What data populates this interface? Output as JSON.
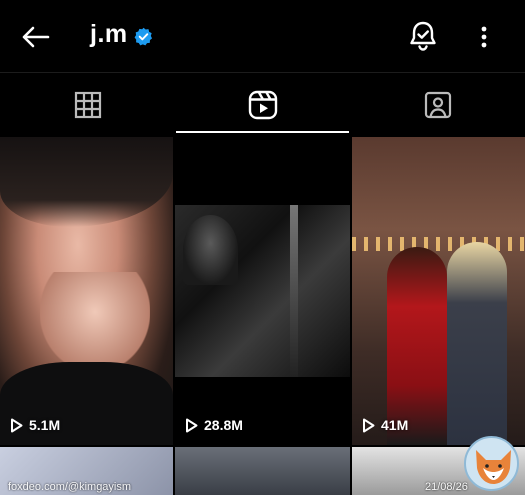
{
  "header": {
    "username": "j.m",
    "verified": true,
    "icons": {
      "back": "back-arrow-icon",
      "bell": "notification-bell-icon",
      "more": "more-vertical-icon",
      "verified": "verified-badge-icon"
    }
  },
  "tabs": [
    {
      "icon": "grid-icon",
      "active": false
    },
    {
      "icon": "reels-icon",
      "active": true
    },
    {
      "icon": "tagged-icon",
      "active": false
    }
  ],
  "reels": [
    {
      "views": "5.1M"
    },
    {
      "views": "28.8M"
    },
    {
      "views": "41M"
    }
  ],
  "overlay": {
    "watermark": "foxdeo.com/@kimgayism",
    "date": "21/08/26"
  },
  "colors": {
    "verified": "#1d9bf0",
    "background": "#000000"
  }
}
